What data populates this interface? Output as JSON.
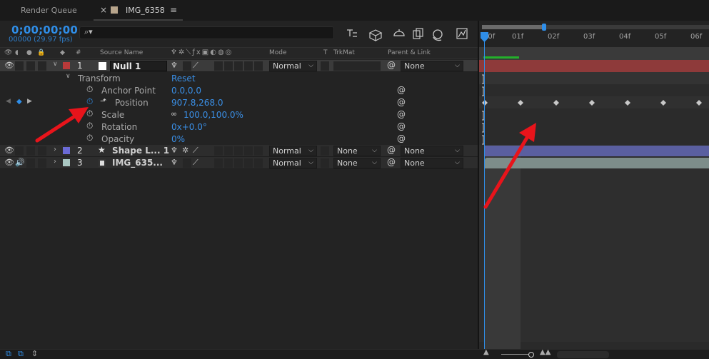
{
  "tabs": {
    "render_queue": "Render Queue",
    "comp_name": "IMG_6358",
    "comp_color": "#b8a58c"
  },
  "timecode": "0;00;00;00",
  "fps": "00000 (29.97 fps)",
  "search": {
    "placeholder": ""
  },
  "columns": {
    "index": "#",
    "source_name": "Source Name",
    "mode": "Mode",
    "t": "T",
    "trkmat": "TrkMat",
    "parent": "Parent & Link"
  },
  "layers": [
    {
      "num": "1",
      "name": "Null 1",
      "label_color": "#b93a3a",
      "mode": "Normal",
      "trkmat": "",
      "parent": "None"
    },
    {
      "num": "2",
      "name": "Shape L... 1",
      "label_color": "#6b6bd6",
      "mode": "Normal",
      "trkmat": "None",
      "parent": "None"
    },
    {
      "num": "3",
      "name": "IMG_635...",
      "label_color": "#a9c7c2",
      "mode": "Normal",
      "trkmat": "None",
      "parent": "None"
    }
  ],
  "transform": {
    "label": "Transform",
    "reset": "Reset",
    "props": [
      {
        "name": "Anchor Point",
        "value": "0.0,0.0"
      },
      {
        "name": "Position",
        "value": "907.8,268.0"
      },
      {
        "name": "Scale",
        "value": "100.0,100.0%"
      },
      {
        "name": "Rotation",
        "value": "0x+0.0°"
      },
      {
        "name": "Opacity",
        "value": "0%"
      }
    ]
  },
  "timeline": {
    "ticks": [
      "00f",
      "01f",
      "02f",
      "03f",
      "04f",
      "05f",
      "06f"
    ]
  },
  "colors": {
    "accent_blue": "#2f8ee8",
    "null_bar": "#8e3a3a",
    "shape_bar": "#5a5fa0",
    "img_bar": "#7d8d8a",
    "annotation_arrow": "#e8141b"
  }
}
